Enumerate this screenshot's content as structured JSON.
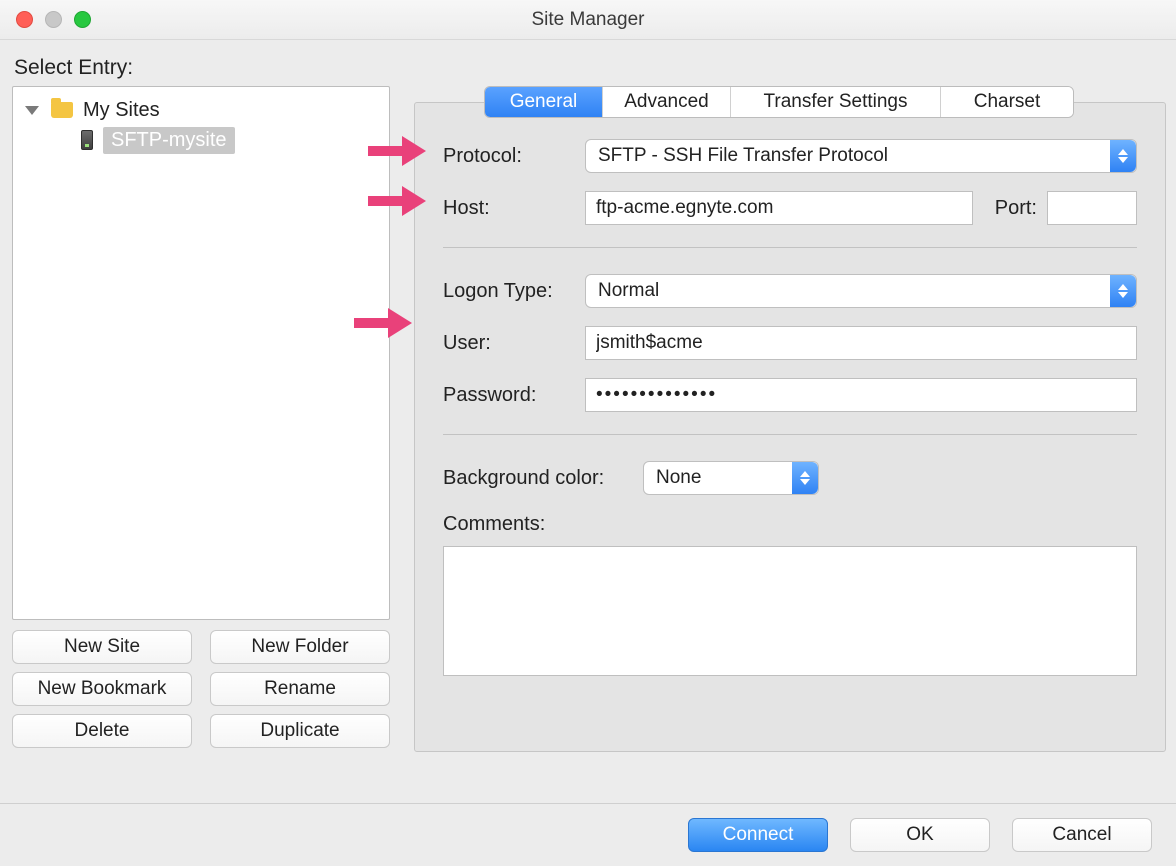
{
  "window": {
    "title": "Site Manager"
  },
  "left": {
    "heading": "Select Entry:",
    "tree": {
      "root_label": "My Sites",
      "site_label": "SFTP-mysite"
    },
    "buttons": {
      "new_site": "New Site",
      "new_folder": "New Folder",
      "new_bookmark": "New Bookmark",
      "rename": "Rename",
      "delete": "Delete",
      "duplicate": "Duplicate"
    }
  },
  "tabs": {
    "general": "General",
    "advanced": "Advanced",
    "transfer": "Transfer Settings",
    "charset": "Charset"
  },
  "form": {
    "protocol_label": "Protocol:",
    "protocol_value": "SFTP - SSH File Transfer Protocol",
    "host_label": "Host:",
    "host_value": "ftp-acme.egnyte.com",
    "port_label": "Port:",
    "port_value": "",
    "logon_type_label": "Logon Type:",
    "logon_type_value": "Normal",
    "user_label": "User:",
    "user_value": "jsmith$acme",
    "password_label": "Password:",
    "password_value": "••••••••••••••",
    "bg_color_label": "Background color:",
    "bg_color_value": "None",
    "comments_label": "Comments:",
    "comments_value": ""
  },
  "footer": {
    "connect": "Connect",
    "ok": "OK",
    "cancel": "Cancel"
  }
}
